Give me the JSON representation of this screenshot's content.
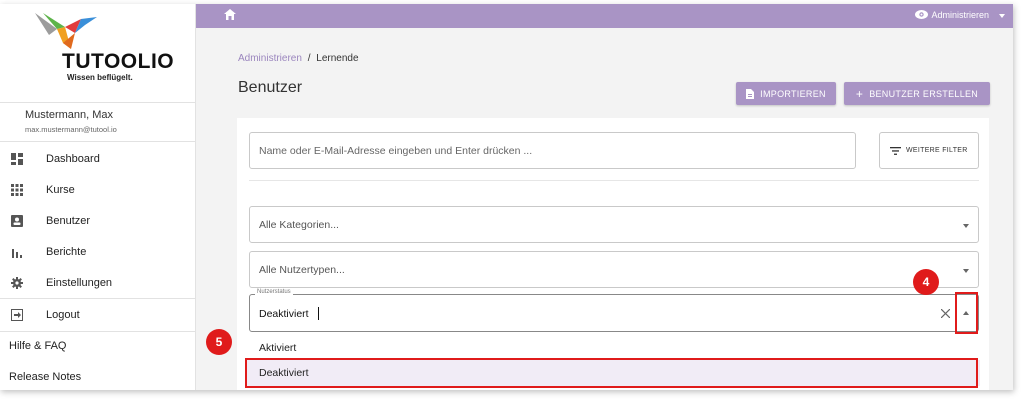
{
  "sidebar": {
    "brand": "TUTOOLIO",
    "tagline": "Wissen beflügelt.",
    "user_name": "Mustermann, Max",
    "user_email": "max.mustermann@tutool.io",
    "items": [
      {
        "label": "Dashboard",
        "icon": "dashboard-icon"
      },
      {
        "label": "Kurse",
        "icon": "grid-icon"
      },
      {
        "label": "Benutzer",
        "icon": "user-card-icon"
      },
      {
        "label": "Berichte",
        "icon": "bar-chart-icon"
      },
      {
        "label": "Einstellungen",
        "icon": "gear-icon"
      },
      {
        "label": "Logout",
        "icon": "logout-icon"
      }
    ],
    "footer": [
      "Hilfe & FAQ",
      "Release Notes"
    ]
  },
  "topbar": {
    "home_icon": "home-icon",
    "admin_label": "Administrieren",
    "admin_icon": "eye-icon"
  },
  "breadcrumb": {
    "parent": "Administrieren",
    "separator": "/",
    "current": "Lernende"
  },
  "page_title": "Benutzer",
  "actions": {
    "import_label": "IMPORTIEREN",
    "create_label": "BENUTZER ERSTELLEN"
  },
  "search": {
    "placeholder": "Name oder E-Mail-Adresse eingeben und Enter drücken ...",
    "filter_label": "WEITERE FILTER"
  },
  "filters": {
    "category": "Alle Kategorien...",
    "usertype": "Alle Nutzertypen...",
    "status_label": "Nutzerstatus",
    "status_value": "Deaktiviert",
    "status_options": [
      "Aktiviert",
      "Deaktiviert"
    ]
  },
  "annotations": {
    "badge_4": "4",
    "badge_5": "5"
  },
  "colors": {
    "accent": "#a994c5",
    "highlight": "#e01b1b"
  }
}
